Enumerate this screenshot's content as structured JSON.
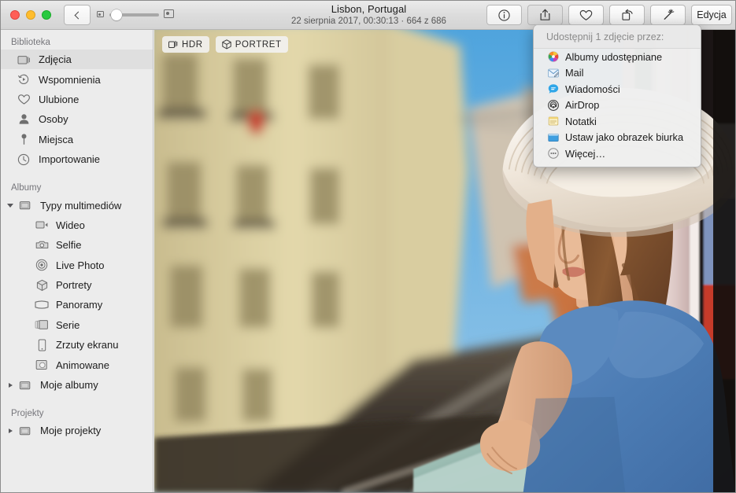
{
  "window": {
    "traffic_lights": {
      "close": "#ff5f57",
      "minimize": "#ffbd2e",
      "zoom": "#28c940"
    }
  },
  "toolbar": {
    "back_label": "",
    "title": "Lisbon, Portugal",
    "subtitle": "22 sierpnia 2017, 00:30:13  ·  664 z 686",
    "zoom_slider": {
      "value": 18,
      "min_icon": "small-thumbnail-icon",
      "max_icon": "large-thumbnail-icon"
    },
    "buttons": [
      {
        "name": "info-button",
        "icon": "info-icon",
        "label": ""
      },
      {
        "name": "share-button",
        "icon": "share-icon",
        "label": "",
        "pressed": true
      },
      {
        "name": "favorite-button",
        "icon": "heart-icon",
        "label": ""
      },
      {
        "name": "rotate-button",
        "icon": "rotate-icon",
        "label": ""
      },
      {
        "name": "enhance-button",
        "icon": "magic-wand-icon",
        "label": ""
      },
      {
        "name": "edit-button",
        "icon": "",
        "label": "Edycja"
      }
    ]
  },
  "sidebar": {
    "section_library": "Biblioteka",
    "library_items": [
      {
        "label": "Zdjęcia",
        "icon": "photos-icon",
        "selected": true
      },
      {
        "label": "Wspomnienia",
        "icon": "memories-icon",
        "selected": false
      },
      {
        "label": "Ulubione",
        "icon": "heart-icon",
        "selected": false
      },
      {
        "label": "Osoby",
        "icon": "person-icon",
        "selected": false
      },
      {
        "label": "Miejsca",
        "icon": "pin-icon",
        "selected": false
      },
      {
        "label": "Importowanie",
        "icon": "clock-icon",
        "selected": false
      }
    ],
    "section_albums": "Albumy",
    "media_types_label": "Typy multimediów",
    "media_types_expanded": true,
    "media_types": [
      {
        "label": "Wideo",
        "icon": "video-icon"
      },
      {
        "label": "Selfie",
        "icon": "camera-icon"
      },
      {
        "label": "Live Photo",
        "icon": "live-photo-icon"
      },
      {
        "label": "Portrety",
        "icon": "cube-icon"
      },
      {
        "label": "Panoramy",
        "icon": "panorama-icon"
      },
      {
        "label": "Serie",
        "icon": "burst-icon"
      },
      {
        "label": "Zrzuty ekranu",
        "icon": "phone-icon"
      },
      {
        "label": "Animowane",
        "icon": "animated-icon"
      }
    ],
    "my_albums_label": "Moje albumy",
    "section_projects": "Projekty",
    "my_projects_label": "Moje projekty"
  },
  "photo": {
    "badges": [
      {
        "label": "HDR",
        "icon": "hdr-icon"
      },
      {
        "label": "PORTRET",
        "icon": "cube-icon"
      }
    ],
    "description": "Lisbon, Portugal - woman in white sun hat and blue dress on balcony"
  },
  "share_menu": {
    "title": "Udostępnij 1 zdjęcie przez:",
    "items": [
      {
        "label": "Albumy udostępniane",
        "icon": "shared-albums-icon"
      },
      {
        "label": "Mail",
        "icon": "mail-icon"
      },
      {
        "label": "Wiadomości",
        "icon": "messages-icon"
      },
      {
        "label": "AirDrop",
        "icon": "airdrop-icon"
      },
      {
        "label": "Notatki",
        "icon": "notes-icon"
      },
      {
        "label": "Ustaw jako obrazek biurka",
        "icon": "desktop-icon"
      },
      {
        "label": "Więcej…",
        "icon": "more-icon"
      }
    ]
  }
}
